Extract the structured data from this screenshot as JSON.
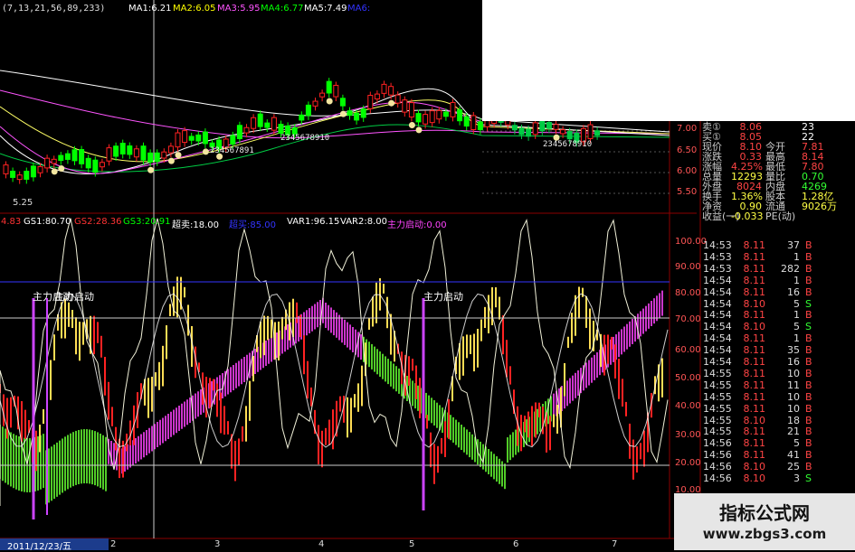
{
  "price_panel": {
    "header_params": "(7,13,21,56,89,233)",
    "ma_items": [
      {
        "label": "MA1:6.21",
        "color": "#ffffff"
      },
      {
        "label": "MA2:6.05",
        "color": "#ffff00"
      },
      {
        "label": "MA3:5.95",
        "color": "#ff55ff"
      },
      {
        "label": "MA4:6.77",
        "color": "#00ff00"
      },
      {
        "label": "MA5:7.49",
        "color": "#ffffff"
      },
      {
        "label": "MA6:",
        "color": "#3333ff"
      }
    ],
    "axis_labels": [
      "7.00",
      "6.50",
      "6.00",
      "5.50"
    ],
    "low_label": "5.25",
    "annotations": [
      "234567891",
      "2345678910",
      "2345678910"
    ]
  },
  "indicator_panel": {
    "header_items": [
      {
        "label": "4.83",
        "color": "#ff3333"
      },
      {
        "label": "GS1:80.70",
        "color": "#ffffff"
      },
      {
        "label": "GS2:28.36",
        "color": "#ff3333"
      },
      {
        "label": "GS3:20.91",
        "color": "#00ff00"
      },
      {
        "label": "超卖:18.00",
        "color": "#ffffff"
      },
      {
        "label": "超买:85.00",
        "color": "#3333ff"
      },
      {
        "label": "VAR1:96.15",
        "color": "#ffffff"
      },
      {
        "label": "VAR2:8.00",
        "color": "#ffffff"
      },
      {
        "label": "主力启动:0.00",
        "color": "#ff44ff"
      }
    ],
    "axis_labels": [
      "100.00",
      "90.00",
      "80.00",
      "70.00",
      "60.00",
      "50.00",
      "40.00",
      "30.00",
      "20.00",
      "10.00"
    ],
    "signal_labels": [
      "主力启动",
      "主力启动",
      "主力启动"
    ]
  },
  "quote": {
    "rows": [
      {
        "label": "卖①",
        "value": "8.06",
        "label2": "",
        "value2": "23",
        "color": "#ff4444",
        "color2": "#ffffff"
      },
      {
        "label": "买①",
        "value": "8.05",
        "label2": "",
        "value2": "22",
        "color": "#ff4444",
        "color2": "#ffffff"
      },
      {
        "label": "现价",
        "value": "8.10",
        "label2": "今开",
        "value2": "7.81",
        "color": "#ff4444",
        "color2": "#ff4444"
      },
      {
        "label": "涨跌",
        "value": "0.33",
        "label2": "最高",
        "value2": "8.14",
        "color": "#ff4444",
        "color2": "#ff4444"
      },
      {
        "label": "涨幅",
        "value": "4.25%",
        "label2": "最低",
        "value2": "7.80",
        "color": "#ff4444",
        "color2": "#ff4444"
      },
      {
        "label": "总量",
        "value": "12293",
        "label2": "量比",
        "value2": "0.70",
        "color": "#ffff44",
        "color2": "#33ff33"
      },
      {
        "label": "外盘",
        "value": "8024",
        "label2": "内盘",
        "value2": "4269",
        "color": "#ff4444",
        "color2": "#33ff33"
      },
      {
        "label": "换手",
        "value": "1.36%",
        "label2": "股本",
        "value2": "1.28亿",
        "color": "#ffff44",
        "color2": "#ffff44"
      },
      {
        "label": "净资",
        "value": "0.90",
        "label2": "流通",
        "value2": "9026万",
        "color": "#ffff44",
        "color2": "#ffff44"
      },
      {
        "label": "收益(一)",
        "value": "-0.033",
        "label2": "PE(动)",
        "value2": "",
        "color": "#ffff44",
        "color2": "#ffff44"
      }
    ]
  },
  "ticks": [
    {
      "time": "14:53",
      "price": "8.11",
      "vol": "37",
      "flag": "B"
    },
    {
      "time": "14:53",
      "price": "8.11",
      "vol": "1",
      "flag": "B"
    },
    {
      "time": "14:53",
      "price": "8.11",
      "vol": "282",
      "flag": "B"
    },
    {
      "time": "14:54",
      "price": "8.11",
      "vol": "1",
      "flag": "B"
    },
    {
      "time": "14:54",
      "price": "8.11",
      "vol": "16",
      "flag": "B"
    },
    {
      "time": "14:54",
      "price": "8.10",
      "vol": "5",
      "flag": "S"
    },
    {
      "time": "14:54",
      "price": "8.11",
      "vol": "1",
      "flag": "B"
    },
    {
      "time": "14:54",
      "price": "8.10",
      "vol": "5",
      "flag": "S"
    },
    {
      "time": "14:54",
      "price": "8.11",
      "vol": "1",
      "flag": "B"
    },
    {
      "time": "14:54",
      "price": "8.11",
      "vol": "35",
      "flag": "B"
    },
    {
      "time": "14:54",
      "price": "8.11",
      "vol": "16",
      "flag": "B"
    },
    {
      "time": "14:55",
      "price": "8.11",
      "vol": "10",
      "flag": "B"
    },
    {
      "time": "14:55",
      "price": "8.11",
      "vol": "11",
      "flag": "B"
    },
    {
      "time": "14:55",
      "price": "8.11",
      "vol": "10",
      "flag": "B"
    },
    {
      "time": "14:55",
      "price": "8.11",
      "vol": "10",
      "flag": "B"
    },
    {
      "time": "14:55",
      "price": "8.10",
      "vol": "18",
      "flag": "B"
    },
    {
      "time": "14:55",
      "price": "8.11",
      "vol": "21",
      "flag": "B"
    },
    {
      "time": "14:56",
      "price": "8.11",
      "vol": "5",
      "flag": "B"
    },
    {
      "time": "14:56",
      "price": "8.11",
      "vol": "41",
      "flag": "B"
    },
    {
      "time": "14:56",
      "price": "8.10",
      "vol": "25",
      "flag": "B"
    },
    {
      "time": "14:56",
      "price": "8.10",
      "vol": "3",
      "flag": "S"
    }
  ],
  "time_axis": {
    "date": "2011/12/23/五",
    "labels": [
      "2",
      "3",
      "4",
      "5",
      "6",
      "7"
    ]
  },
  "watermark": {
    "title": "指标公式网",
    "url": "www.zbgs3.com"
  },
  "colors": {
    "up": "#ff2222",
    "down": "#00ff00",
    "buy": "#ff4444",
    "sell": "#33ff33",
    "magenta": "#ff44ff",
    "grid": "#8b0000",
    "yellow": "#ffff66"
  }
}
